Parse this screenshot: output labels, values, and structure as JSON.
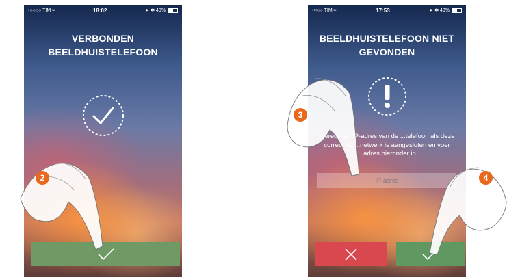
{
  "left_screen": {
    "status": {
      "carrier": "•○○○○ TIM",
      "time": "18:02",
      "battery": "49%"
    },
    "title_line1": "VERBONDEN",
    "title_line2": "BEELDHUISTELEFOON",
    "icon": "check-circle-icon",
    "confirm_icon": "check-icon",
    "step_badge": "2"
  },
  "right_screen": {
    "status": {
      "carrier": "•••○○ TIM",
      "time": "17:53",
      "battery": "49%"
    },
    "title_line1": "BEELDHUISTELEFOON NIET",
    "title_line2": "GEVONDEN",
    "icon": "exclamation-circle-icon",
    "message": "...ereer het IP-adres van de ...telefoon als deze correct op ...netwerk is aangesloten en voer ...adres hieronder in",
    "ip_placeholder": "IP-adres",
    "cancel_icon": "close-icon",
    "confirm_icon": "check-icon",
    "step_badges": [
      "3",
      "4"
    ]
  },
  "colors": {
    "confirm_green": "#6f9a66",
    "cancel_red": "#d9474f",
    "badge_orange": "#e8681d"
  }
}
